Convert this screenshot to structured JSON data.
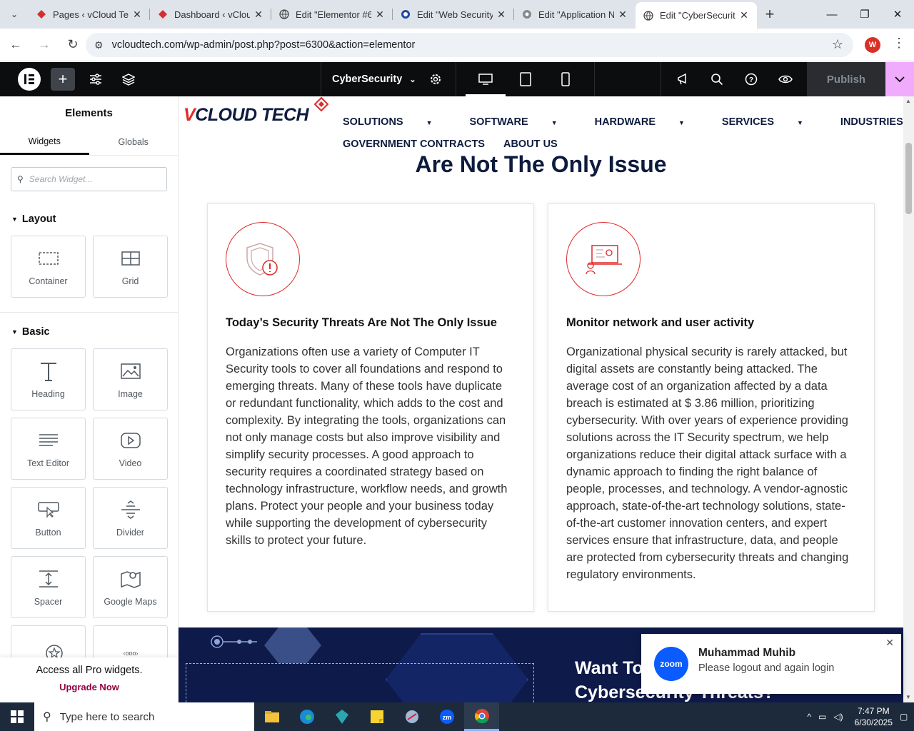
{
  "browser": {
    "tabs": [
      {
        "title": "Pages ‹ vCloud Tec",
        "icon": "elementor-red-icon"
      },
      {
        "title": "Dashboard ‹ vClou",
        "icon": "elementor-red-icon"
      },
      {
        "title": "Edit \"Elementor #6",
        "icon": "globe-icon"
      },
      {
        "title": "Edit \"Web Security",
        "icon": "blue-circle-icon"
      },
      {
        "title": "Edit \"Application N",
        "icon": "chrome-icon"
      },
      {
        "title": "Edit \"CyberSecurity",
        "icon": "globe-icon",
        "active": true
      }
    ],
    "url": "vcloudtech.com/wp-admin/post.php?post=6300&action=elementor",
    "profile_initial": "W"
  },
  "elementor": {
    "document_name": "CyberSecurity",
    "publish_label": "Publish",
    "panel": {
      "title": "Elements",
      "tabs": [
        "Widgets",
        "Globals"
      ],
      "search_placeholder": "Search Widget...",
      "layout_label": "Layout",
      "basic_label": "Basic",
      "layout_widgets": [
        "Container",
        "Grid"
      ],
      "basic_widgets": [
        "Heading",
        "Image",
        "Text Editor",
        "Video",
        "Button",
        "Divider",
        "Spacer",
        "Google Maps"
      ],
      "pro_text": "Access all Pro widgets.",
      "upgrade_label": "Upgrade Now"
    }
  },
  "site": {
    "brand_v": "V",
    "brand_rest": "CLOUD TECH",
    "nav_row1": [
      "SOLUTIONS",
      "SOFTWARE",
      "HARDWARE",
      "SERVICES",
      "INDUSTRIES"
    ],
    "nav_row2": [
      "GOVERNMENT CONTRACTS",
      "ABOUT US"
    ],
    "section_heading": "Are Not The Only Issue",
    "cards": [
      {
        "title": "Today’s Security Threats Are Not The Only Issue",
        "body": "Organizations often use a variety of Computer IT Security tools to cover all foundations and respond to emerging threats. Many of these tools have duplicate or redundant functionality, which adds to the cost and complexity. By integrating the tools, organizations can not only manage costs but also improve visibility and simplify security processes. A good approach to security requires a coordinated strategy based on technology infrastructure, workflow needs, and growth plans. Protect your people and your business today while supporting the development of cybersecurity skills to protect your future."
      },
      {
        "title": "Monitor network and user activity",
        "body": "Organizational physical security is rarely attacked, but digital assets are constantly being attacked. The average cost of an organization affected by a data breach is estimated at $ 3.86 million, prioritizing cybersecurity. With over years of experience providing solutions across the IT Security spectrum, we help organizations reduce their digital attack surface with a dynamic approach to finding the right balance of people, processes, and technology. A vendor-agnostic approach, state-of-the-art technology solutions, state-of-the-art customer innovation centers, and expert services ensure that infrastructure, data, and people are protected from cybersecurity threats and changing regulatory environments."
      }
    ],
    "banner_line1": "Want To",
    "banner_line2": "Cybersecurity Threats?"
  },
  "toast": {
    "logo": "zoom",
    "name": "Muhammad Muhib",
    "message": "Please logout and again login"
  },
  "taskbar": {
    "search_placeholder": "Type here to search",
    "time": "7:47 PM",
    "date": "6/30/2025"
  }
}
